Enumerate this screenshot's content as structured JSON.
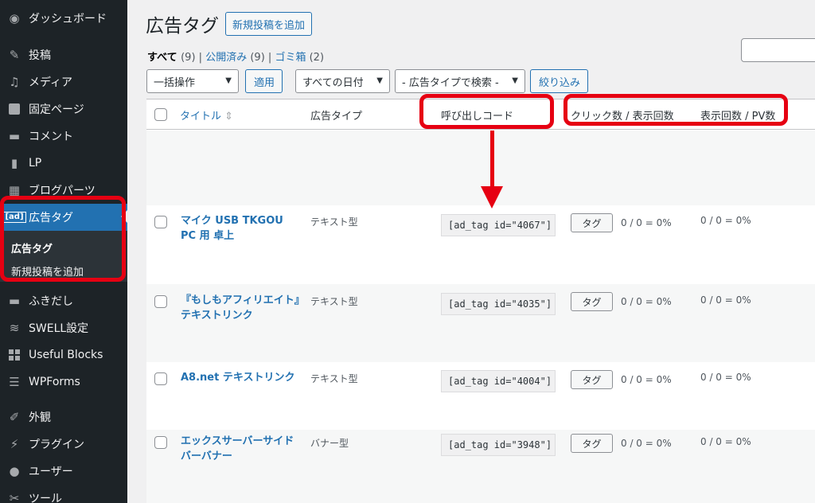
{
  "sidebar": {
    "items": [
      {
        "icon": "dashboard-icon",
        "label": "ダッシュボード"
      },
      {
        "icon": "pin-icon",
        "label": "投稿"
      },
      {
        "icon": "media-icon",
        "label": "メディア"
      },
      {
        "icon": "page-icon",
        "label": "固定ページ"
      },
      {
        "icon": "comment-icon",
        "label": "コメント"
      },
      {
        "icon": "document-icon",
        "label": "LP"
      },
      {
        "icon": "layout-icon",
        "label": "ブログパーツ"
      },
      {
        "icon": "ad-icon",
        "label": "広告タグ",
        "badge": "[ad]"
      },
      {
        "icon": "speech-bubble-icon",
        "label": "ふきだし"
      },
      {
        "icon": "swell-icon",
        "label": "SWELL設定"
      },
      {
        "icon": "blocks-icon",
        "label": "Useful Blocks"
      },
      {
        "icon": "forms-icon",
        "label": "WPForms"
      },
      {
        "icon": "brush-icon",
        "label": "外観"
      },
      {
        "icon": "plugin-icon",
        "label": "プラグイン"
      },
      {
        "icon": "user-icon",
        "label": "ユーザー"
      },
      {
        "icon": "tools-icon",
        "label": "ツール"
      }
    ],
    "submenu": {
      "current": "広告タグ",
      "add_new": "新規投稿を追加"
    }
  },
  "header": {
    "title": "広告タグ",
    "add_new_button": "新規投稿を追加"
  },
  "filters": {
    "all": "すべて",
    "all_count": "(9)",
    "published": "公開済み",
    "published_count": "(9)",
    "trash": "ゴミ箱",
    "trash_count": "(2)",
    "sep": "|"
  },
  "toolbar": {
    "bulk_action": "一括操作",
    "apply": "適用",
    "date_filter": "すべての日付",
    "type_filter": "- 広告タイプで検索 -",
    "filter_button": "絞り込み"
  },
  "table": {
    "columns": {
      "title": "タイトル",
      "type": "広告タイプ",
      "code": "呼び出しコード",
      "clicks": "クリック数 / 表示回数",
      "views": "表示回数 / PV数"
    },
    "tag_button": "タグ",
    "rows": [
      {
        "title": "マイク USB TKGOU PC 用 卓上",
        "type": "テキスト型",
        "code": "[ad_tag id=\"4067\"]",
        "clicks": "0 / 0 = 0%",
        "views": "0 / 0 = 0%"
      },
      {
        "title": "『もしもアフィリエイト』テキストリンク",
        "type": "テキスト型",
        "code": "[ad_tag id=\"4035\"]",
        "clicks": "0 / 0 = 0%",
        "views": "0 / 0 = 0%"
      },
      {
        "title": "A8.net テキストリンク",
        "type": "テキスト型",
        "code": "[ad_tag id=\"4004\"]",
        "clicks": "0 / 0 = 0%",
        "views": "0 / 0 = 0%"
      },
      {
        "title": "エックスサーバーサイドバーバナー",
        "type": "バナー型",
        "code": "[ad_tag id=\"3948\"]",
        "clicks": "0 / 0 = 0%",
        "views": "0 / 0 = 0%"
      }
    ]
  },
  "colors": {
    "sidebar_bg": "#1d2327",
    "accent": "#2271b1",
    "annotation": "#e60012"
  }
}
